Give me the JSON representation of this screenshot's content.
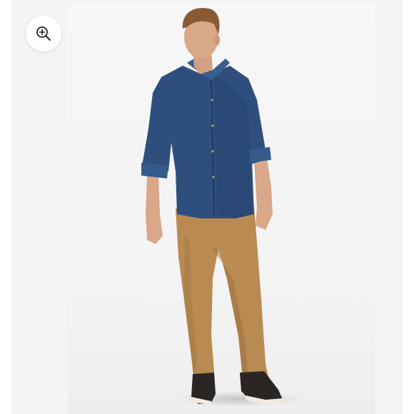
{
  "viewer": {
    "zoom_button": {
      "icon": "zoom-in-icon"
    },
    "photo": {
      "subject": "model-wearing-shirt-and-chinos"
    }
  },
  "colors": {
    "shirt": "#2e4f7e",
    "shirt_dark": "#223c63",
    "pants": "#b98a52",
    "pants_dark": "#9c7140",
    "shoes": "#2b2623",
    "skin": "#d9a889",
    "hair": "#8a5a35",
    "background": "#f3f3f4"
  }
}
